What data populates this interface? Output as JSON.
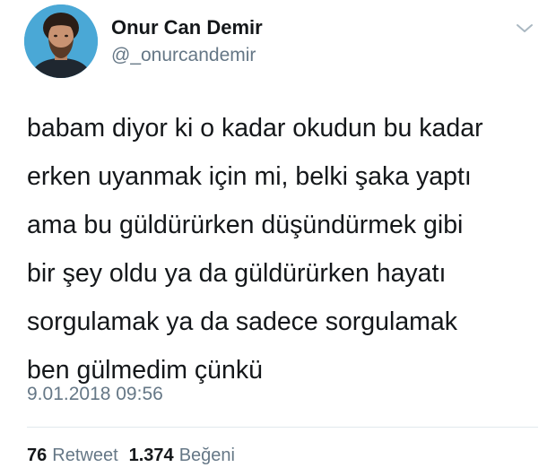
{
  "tweet": {
    "author": {
      "display_name": "Onur Can Demir",
      "handle": "@_onurcandemir"
    },
    "text_lines": [
      "babam diyor ki o kadar okudun bu kadar",
      "erken uyanmak için mi, belki şaka yaptı",
      "ama bu güldürürken düşündürmek gibi",
      "bir şey oldu ya da güldürürken hayatı",
      "sorgulamak ya da sadece sorgulamak",
      "ben gülmedim çünkü"
    ],
    "timestamp": "9.01.2018 09:56",
    "stats": {
      "retweets": "76",
      "retweets_label": "Retweet",
      "likes": "1.374",
      "likes_label": "Beğeni"
    }
  },
  "icons": {
    "caret": "chevron-down-icon"
  },
  "colors": {
    "primary_text": "#14171a",
    "secondary_text": "#657786",
    "divider": "#e1e8ed",
    "avatar_background": "#4aa8d6"
  }
}
